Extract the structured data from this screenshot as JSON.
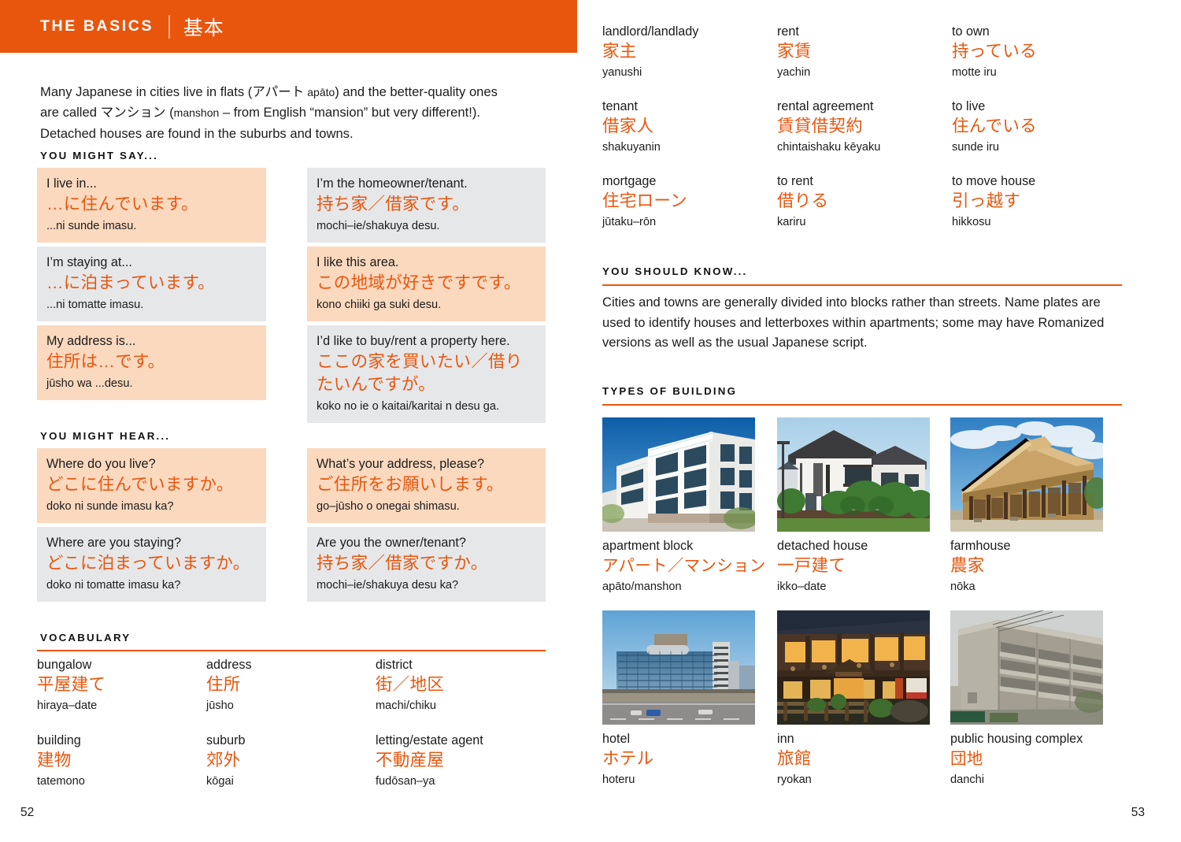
{
  "header": {
    "title": "THE BASICS",
    "separator": "|",
    "title_jp": "基本",
    "band_color": "#E8560E"
  },
  "colors": {
    "accent": "#E8560E",
    "peach_box": "#FBD9BF",
    "grey_box": "#E6E7E9",
    "text": "#1B1B1B"
  },
  "left_page": {
    "intro_parts": {
      "p1": "Many Japanese in cities live in flats (",
      "jp1": "アパート",
      "rom1": " apāto",
      "p2": ") and the better-quality ones are called ",
      "jp2": "マンション",
      "p3": " (",
      "rom2": "manshon",
      "p4": " – from English “mansion” but very different!). Detached houses are found in the suburbs and towns."
    },
    "you_might_say_heading": "YOU MIGHT SAY...",
    "you_might_say": {
      "left": [
        {
          "en": "I live in...",
          "jp": "…に住んでいます。",
          "rom": "...ni sunde imasu.",
          "style": "peach"
        },
        {
          "en": "I’m staying at...",
          "jp": "…に泊まっています。",
          "rom": "...ni tomatte imasu.",
          "style": "grey"
        },
        {
          "en": "My address is...",
          "jp": "住所は…です。",
          "rom": "jūsho wa ...desu.",
          "style": "peach"
        }
      ],
      "right": [
        {
          "en": "I’m the homeowner/tenant.",
          "jp": "持ち家／借家です。",
          "rom": "mochi–ie/shakuya desu.",
          "style": "grey"
        },
        {
          "en": "I like this area.",
          "jp": "この地域が好きですです。",
          "rom": "kono chiiki ga suki desu.",
          "style": "peach"
        },
        {
          "en": "I’d like to buy/rent a property here.",
          "jp": "ここの家を買いたい／借りたいんですが。",
          "rom": "koko no ie o kaitai/karitai n desu ga.",
          "style": "grey"
        }
      ]
    },
    "you_might_hear_heading": "YOU MIGHT HEAR...",
    "you_might_hear": {
      "left": [
        {
          "en": "Where do you live?",
          "jp": "どこに住んでいますか。",
          "rom": "doko ni sunde imasu ka?",
          "style": "peach"
        },
        {
          "en": "Where are you staying?",
          "jp": "どこに泊まっていますか。",
          "rom": "doko ni tomatte imasu ka?",
          "style": "grey"
        }
      ],
      "right": [
        {
          "en": "What’s your address, please?",
          "jp": "ご住所をお願いします。",
          "rom": "go–jūsho o onegai shimasu.",
          "style": "peach"
        },
        {
          "en": "Are you the owner/tenant?",
          "jp": "持ち家／借家ですか。",
          "rom": "mochi–ie/shakuya desu ka?",
          "style": "grey"
        }
      ]
    },
    "vocabulary_heading": "VOCABULARY",
    "vocabulary": [
      {
        "en": "bungalow",
        "jp": "平屋建て",
        "rom": "hiraya–date"
      },
      {
        "en": "address",
        "jp": "住所",
        "rom": "jūsho"
      },
      {
        "en": "district",
        "jp": "街／地区",
        "rom": "machi/chiku"
      },
      {
        "en": "building",
        "jp": "建物",
        "rom": "tatemono"
      },
      {
        "en": "suburb",
        "jp": "郊外",
        "rom": "kōgai"
      },
      {
        "en": "letting/estate agent",
        "jp": "不動産屋",
        "rom": "fudōsan–ya"
      }
    ],
    "folio": "52"
  },
  "right_page": {
    "vocabulary": [
      {
        "en": "landlord/landlady",
        "jp": "家主",
        "rom": "yanushi"
      },
      {
        "en": "rent",
        "jp": "家賃",
        "rom": "yachin"
      },
      {
        "en": "to own",
        "jp": "持っている",
        "rom": "motte iru"
      },
      {
        "en": "tenant",
        "jp": "借家人",
        "rom": "shakuyanin"
      },
      {
        "en": "rental agreement",
        "jp": "賃貸借契約",
        "rom": "chintaishaku kēyaku"
      },
      {
        "en": "to live",
        "jp": "住んでいる",
        "rom": "sunde iru"
      },
      {
        "en": "mortgage",
        "jp": "住宅ローン",
        "rom": "jūtaku–rōn"
      },
      {
        "en": "to rent",
        "jp": "借りる",
        "rom": "kariru"
      },
      {
        "en": "to move house",
        "jp": "引っ越す",
        "rom": "hikkosu"
      }
    ],
    "you_should_know_heading": "YOU SHOULD KNOW...",
    "you_should_know_body": "Cities and towns are generally divided into blocks rather than streets. Name plates are used to identify houses and letterboxes within apartments; some may have Romanized versions as well as the usual Japanese script.",
    "types_of_building_heading": "TYPES OF BUILDING",
    "buildings": [
      {
        "en": "apartment block",
        "jp": "アパート／マンション",
        "rom": "apāto/manshon",
        "photo": "apartment-block-photo"
      },
      {
        "en": "detached house",
        "jp": "一戸建て",
        "rom": "ikko–date",
        "photo": "detached-house-photo"
      },
      {
        "en": "farmhouse",
        "jp": "農家",
        "rom": "nōka",
        "photo": "farmhouse-photo"
      },
      {
        "en": "hotel",
        "jp": "ホテル",
        "rom": "hoteru",
        "photo": "hotel-photo"
      },
      {
        "en": "inn",
        "jp": "旅館",
        "rom": "ryokan",
        "photo": "inn-photo"
      },
      {
        "en": "public housing complex",
        "jp": "団地",
        "rom": "danchi",
        "photo": "public-housing-photo"
      }
    ],
    "folio": "53"
  }
}
